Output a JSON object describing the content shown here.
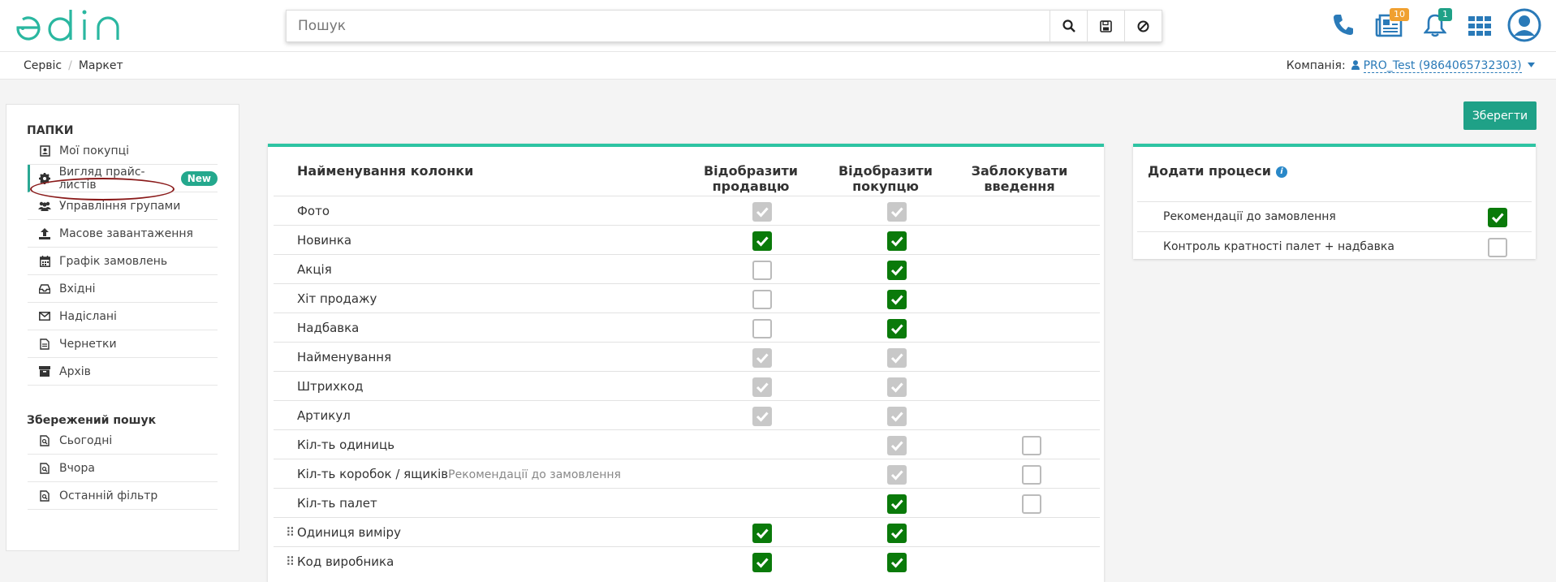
{
  "header": {
    "logo_text": "edin",
    "search_placeholder": "Пошук",
    "news_badge": "10",
    "notifications_badge": "1"
  },
  "breadcrumb": {
    "items": [
      "Сервіс",
      "Маркет"
    ]
  },
  "company": {
    "label": "Компанія:",
    "value": "PRO_Test (9864065732303)"
  },
  "sidebar": {
    "folders_title": "ПАПКИ",
    "items": [
      {
        "label": "Мої покупці",
        "icon": "contact-icon"
      },
      {
        "label": "Вигляд прайс-листів",
        "icon": "gear-icon",
        "badge": "New",
        "active": true
      },
      {
        "label": "Управління групами",
        "icon": "users-icon"
      },
      {
        "label": "Масове завантаження",
        "icon": "upload-icon"
      },
      {
        "label": "Графік замовлень",
        "icon": "calendar-icon"
      },
      {
        "label": "Вхідні",
        "icon": "inbox-icon"
      },
      {
        "label": "Надіслані",
        "icon": "envelope-icon"
      },
      {
        "label": "Чернетки",
        "icon": "file-icon"
      },
      {
        "label": "Архів",
        "icon": "archive-icon"
      }
    ],
    "saved_title": "Збережений пошук",
    "saved": [
      {
        "label": "Сьогодні",
        "icon": "file-icon"
      },
      {
        "label": "Вчора",
        "icon": "file-icon"
      },
      {
        "label": "Останній фільтр",
        "icon": "file-icon"
      }
    ]
  },
  "toolbar": {
    "save_label": "Зберегти"
  },
  "table": {
    "headers": {
      "name": "Найменування колонки",
      "seller": [
        "Відобразити",
        "продавцю"
      ],
      "buyer": [
        "Відобразити",
        "покупцю"
      ],
      "lock": [
        "Заблокувати",
        "введення"
      ]
    },
    "rows": [
      {
        "label": "Фото",
        "seller": "disabled",
        "buyer": "disabled",
        "lock": null
      },
      {
        "label": "Новинка",
        "seller": "checked",
        "buyer": "checked",
        "lock": null
      },
      {
        "label": "Акція",
        "seller": "empty",
        "buyer": "checked",
        "lock": null
      },
      {
        "label": "Хіт продажу",
        "seller": "empty",
        "buyer": "checked",
        "lock": null
      },
      {
        "label": "Надбавка",
        "seller": "empty",
        "buyer": "checked",
        "lock": null
      },
      {
        "label": "Найменування",
        "seller": "disabled",
        "buyer": "disabled",
        "lock": null
      },
      {
        "label": "Штрихкод",
        "seller": "disabled",
        "buyer": "disabled",
        "lock": null
      },
      {
        "label": "Артикул",
        "seller": "disabled",
        "buyer": "disabled",
        "lock": null
      },
      {
        "label": "Кіл-ть одиниць",
        "seller": null,
        "buyer": "disabled",
        "lock": "empty"
      },
      {
        "label": "Кіл-ть коробок / ящиків",
        "extra": "Рекомендації до замовлення",
        "seller": null,
        "buyer": "disabled",
        "lock": "empty"
      },
      {
        "label": "Кіл-ть палет",
        "seller": null,
        "buyer": "checked",
        "lock": "empty"
      },
      {
        "label": "Одиниця виміру",
        "drag": true,
        "seller": "checked",
        "buyer": "checked",
        "lock": null
      },
      {
        "label": "Код виробника",
        "drag": true,
        "seller": "checked",
        "buyer": "checked",
        "lock": null
      }
    ]
  },
  "processes": {
    "title": "Додати процеси",
    "items": [
      {
        "label": "Рекомендації до замовлення",
        "state": "checked"
      },
      {
        "label": "Контроль кратності палет + надбавка",
        "state": "empty"
      }
    ]
  },
  "colors": {
    "accent": "#2ec4a3",
    "save": "#1fa187",
    "checked": "#0a7a0a",
    "link": "#2a7ab8"
  }
}
